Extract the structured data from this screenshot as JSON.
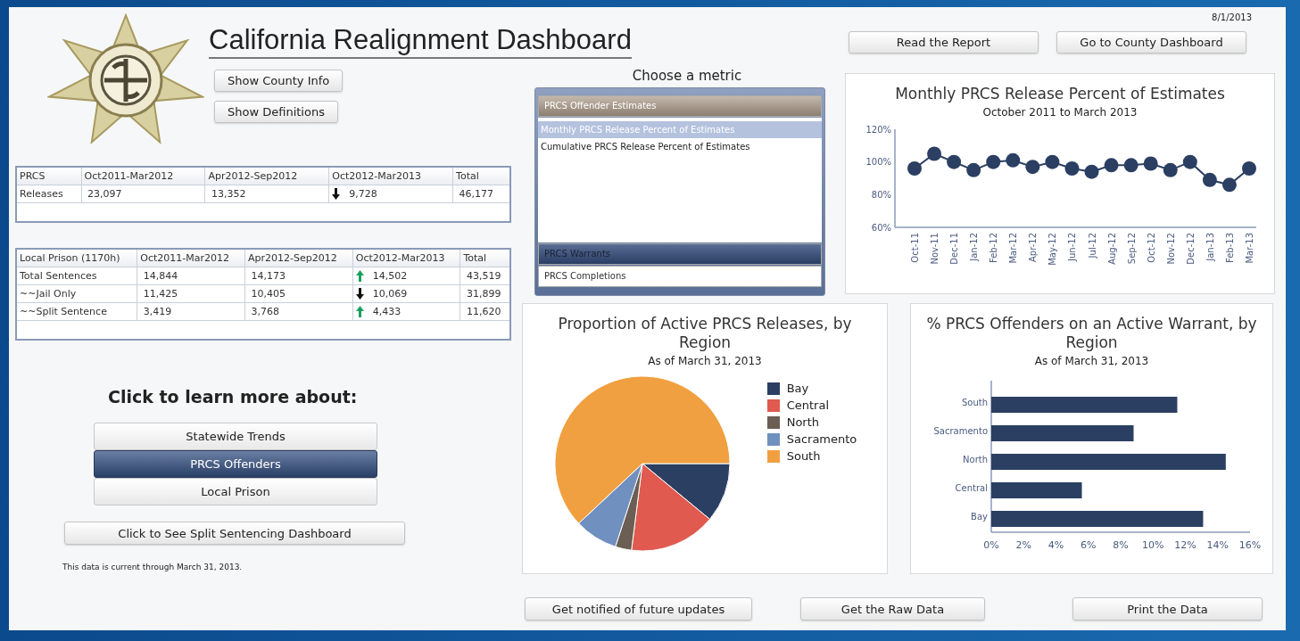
{
  "header": {
    "title": "California Realignment Dashboard",
    "buttons": [
      "Show County Info",
      "Show Definitions"
    ],
    "date": "8/1/2013"
  },
  "tables": [
    {
      "columns": [
        "PRCS",
        "Oct2011-Mar2012",
        "Apr2012-Sep2012",
        "Oct2012-Mar2013",
        "Total"
      ],
      "rows": [
        {
          "label": "Releases",
          "values": [
            "23,097",
            "13,352",
            "9,728",
            "46,177"
          ],
          "increase": false
        }
      ]
    },
    {
      "columns": [
        "Local Prison (1170h)",
        "Oct2011-Mar2012",
        "Apr2012-Sep2012",
        "Oct2012-Mar2013",
        "Total"
      ],
      "rows": [
        {
          "label": "Total Sentences",
          "values": [
            "14,844",
            "14,173",
            "14,502",
            "43,519"
          ],
          "increase": true
        },
        {
          "label": "~~Jail Only",
          "values": [
            "11,425",
            "10,405",
            "10,069",
            "31,899"
          ],
          "increase": false
        },
        {
          "label": "~~Split Sentence",
          "values": [
            "3,419",
            "3,768",
            "4,433",
            "11,620"
          ],
          "increase": true
        }
      ]
    }
  ],
  "learn_more": {
    "heading": "Click to learn more about:",
    "options": [
      {
        "label": "Statewide Trends",
        "selected": false
      },
      {
        "label": "PRCS Offenders",
        "selected": true
      },
      {
        "label": "Local Prison",
        "selected": false
      }
    ]
  },
  "split_button": "Click to See Split Sentencing Dashboard",
  "footnote": "This data is current through March 31, 2013.",
  "top_buttons": [
    "Read the Report",
    "Go to County Dashboard"
  ],
  "metric_chooser": {
    "label": "Choose a metric",
    "groups": [
      {
        "label": "PRCS Offender Estimates",
        "expanded": true,
        "highlighted": false,
        "items": [
          {
            "label": "Monthly PRCS Release Percent of Estimates",
            "selected": true
          },
          {
            "label": "Cumulative PRCS Release Percent of Estimates",
            "selected": false
          }
        ]
      },
      {
        "label": "PRCS Warrants",
        "expanded": false,
        "highlighted": true
      },
      {
        "label": "PRCS Completions",
        "expanded": false,
        "highlighted": false
      }
    ]
  },
  "line_panel": {
    "subtitle": "October 2011 to March 2013",
    "chart_data": {
      "type": "line",
      "title": "Monthly PRCS Release Percent of Estimates",
      "categories": [
        "Oct-11",
        "Nov-11",
        "Dec-11",
        "Jan-12",
        "Feb-12",
        "Mar-12",
        "Apr-12",
        "May-12",
        "Jun-12",
        "Jul-12",
        "Aug-12",
        "Sep-12",
        "Oct-12",
        "Nov-12",
        "Dec-12",
        "Jan-13",
        "Feb-13",
        "Mar-13"
      ],
      "series": [
        {
          "color": "#2b3f63",
          "marker": "circle",
          "values": [
            96,
            105,
            100,
            95,
            100,
            101,
            97,
            100,
            96,
            94,
            98,
            98,
            99,
            95,
            100,
            89,
            86,
            96
          ]
        }
      ],
      "ylim": [
        60,
        120
      ],
      "yticks": [
        {
          "value": 60,
          "label": "60%"
        },
        {
          "value": 80,
          "label": "80%"
        },
        {
          "value": 100,
          "label": "100%"
        },
        {
          "value": 120,
          "label": "120%"
        }
      ]
    }
  },
  "pie_panel": {
    "subtitle": "As of March 31, 2013",
    "chart_data": {
      "type": "pie",
      "title": "Proportion of Active PRCS Releases, by Region",
      "categories": [
        "Bay",
        "Central",
        "North",
        "Sacramento",
        "South"
      ],
      "values": [
        11,
        16,
        3,
        8,
        62
      ],
      "colors": [
        "#2b3f63",
        "#e05a4f",
        "#6b5e52",
        "#7090c0",
        "#f0a040"
      ],
      "legend": "right"
    }
  },
  "bar_panel": {
    "subtitle": "As of March 31, 2013",
    "chart_data": {
      "type": "bar",
      "orientation": "horizontal",
      "title": "% PRCS Offenders on an Active Warrant, by Region",
      "categories": [
        "South",
        "Sacramento",
        "North",
        "Central",
        "Bay"
      ],
      "series": [
        {
          "color": "#2b3f63",
          "values": [
            11.5,
            8.8,
            14.5,
            5.6,
            13.1
          ]
        }
      ],
      "xlim": [
        0,
        16
      ],
      "xticks": [
        {
          "value": 0,
          "label": "0%"
        },
        {
          "value": 2,
          "label": "2%"
        },
        {
          "value": 4,
          "label": "4%"
        },
        {
          "value": 6,
          "label": "6%"
        },
        {
          "value": 8,
          "label": "8%"
        },
        {
          "value": 10,
          "label": "10%"
        },
        {
          "value": 12,
          "label": "12%"
        },
        {
          "value": 14,
          "label": "14%"
        },
        {
          "value": 16,
          "label": "16%"
        }
      ]
    }
  },
  "bottom_buttons": [
    "Get notified of future updates",
    "Get the Raw Data",
    "Print the Data"
  ]
}
